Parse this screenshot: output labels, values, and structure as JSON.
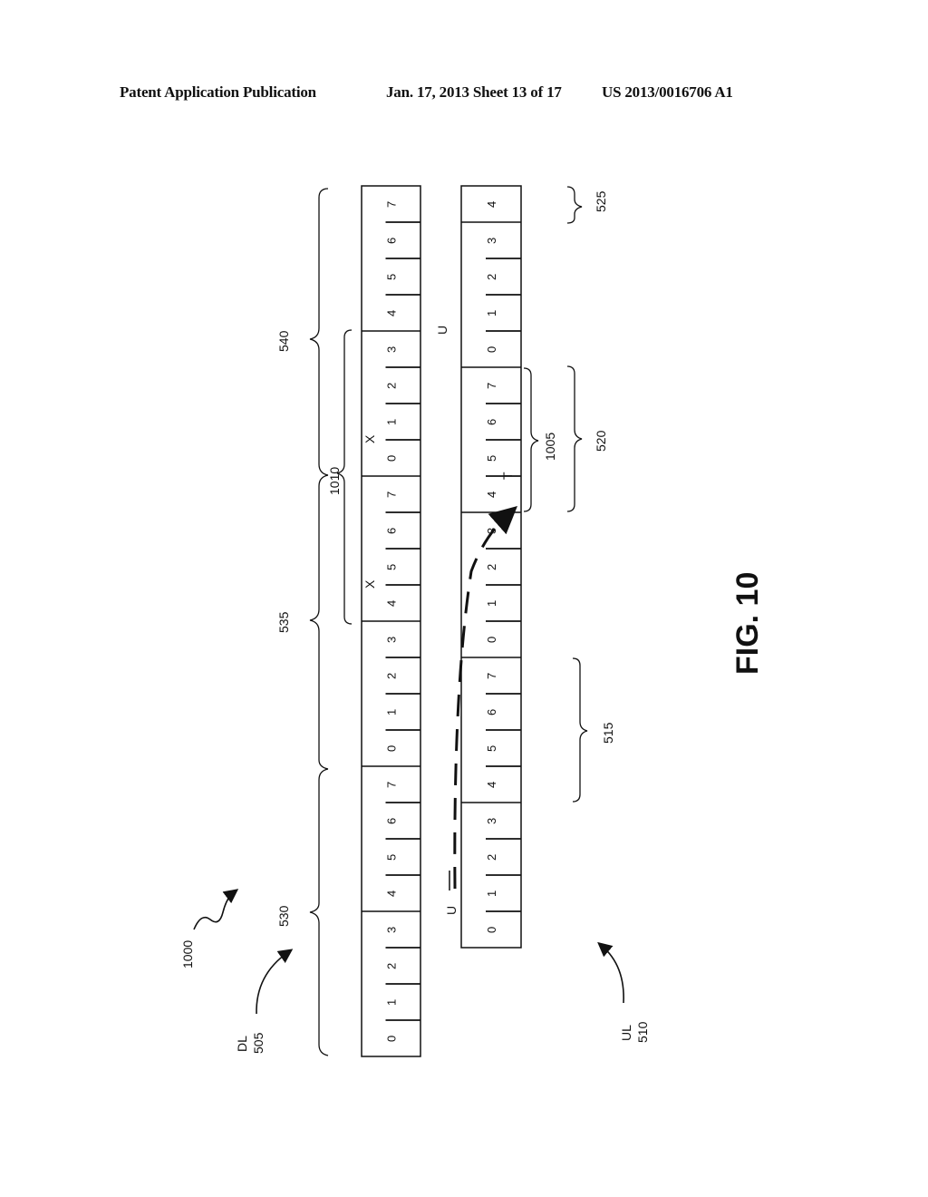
{
  "header": {
    "left": "Patent Application Publication",
    "middle": "Jan. 17, 2013   Sheet 13 of 17",
    "right": "US 2013/0016706 A1"
  },
  "figure": {
    "title": "FIG. 10",
    "ref_number": "1000",
    "downlink": {
      "label": "DL",
      "ref": "505",
      "subframes": [
        "0",
        "1",
        "2",
        "3",
        "4",
        "5",
        "6",
        "7",
        "0",
        "1",
        "2",
        "3",
        "4",
        "5",
        "6",
        "7",
        "0",
        "1",
        "2",
        "3",
        "4",
        "5",
        "6",
        "7"
      ],
      "frame_refs": [
        "530",
        "535",
        "540"
      ],
      "markers": [
        {
          "subframe_index": 13,
          "symbol": "X"
        },
        {
          "subframe_index": 17,
          "symbol": "X"
        }
      ]
    },
    "uplink": {
      "label": "UL",
      "ref": "510",
      "subframes": [
        "0",
        "1",
        "2",
        "3",
        "4",
        "5",
        "6",
        "7",
        "0",
        "1",
        "2",
        "3",
        "4",
        "5",
        "6",
        "7",
        "0",
        "1",
        "2",
        "3",
        "4"
      ],
      "markers": [
        {
          "subframe_index": 1,
          "symbol": "U"
        },
        {
          "subframe_index": 13,
          "symbol": "T"
        },
        {
          "subframe_index": 17,
          "symbol": "U"
        }
      ],
      "group_refs": [
        "515",
        "520",
        "525"
      ]
    },
    "window_refs": [
      "1005",
      "1010"
    ]
  }
}
